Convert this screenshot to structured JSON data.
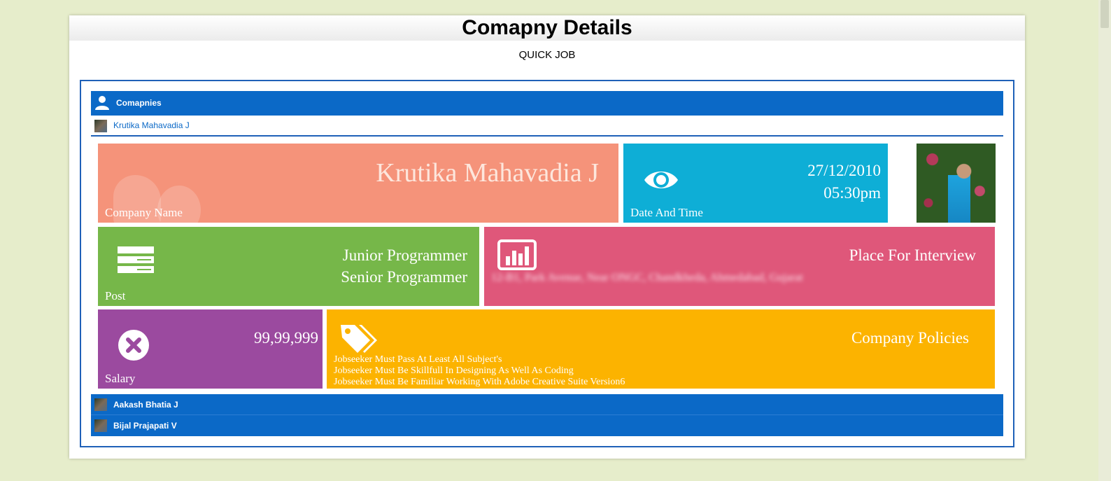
{
  "page": {
    "title": "Comapny Details",
    "subtitle": "QUICK JOB"
  },
  "companies": {
    "header_label": "Comapnies",
    "header_icon": "user-icon",
    "active_item": "Krutika Mahavadia J",
    "other_items": [
      {
        "label": "Aakash Bhatia J"
      },
      {
        "label": "Bijal Prajapati V"
      }
    ]
  },
  "details": {
    "company": {
      "value": "Krutika Mahavadia J",
      "label": "Company Name",
      "color": "#f5937a"
    },
    "date_time": {
      "date": "27/12/2010",
      "time": "05:30pm",
      "label": "Date And Time",
      "icon": "eye-icon",
      "color": "#0eaed6"
    },
    "post": {
      "values": [
        "Junior Programmer",
        "Senior Programmer"
      ],
      "label": "Post",
      "icon": "server-icon",
      "color": "#76b749"
    },
    "place": {
      "title": "Place For Interview",
      "address": "12-B1, Park Avenue, Near ONGC, Chandkheda, Ahmedabad, Gujarat",
      "icon": "bar-chart-icon",
      "color": "#df577a"
    },
    "salary": {
      "amount": "99,99,999",
      "label": "Salary",
      "icon": "close-circle-icon",
      "color": "#9b4a9f"
    },
    "policies": {
      "title": "Company Policies",
      "icon": "tags-icon",
      "color": "#fcb300",
      "items": [
        "Jobseeker Must Pass At Least All Subject's",
        "Jobseeker Must Be Skillfull In Designing As Well As Coding",
        "Jobseeker Must Be Familiar Working With Adobe Creative Suite Version6"
      ]
    }
  },
  "colors": {
    "bar_blue": "#0b69c7",
    "page_bg": "#e6edcb"
  }
}
